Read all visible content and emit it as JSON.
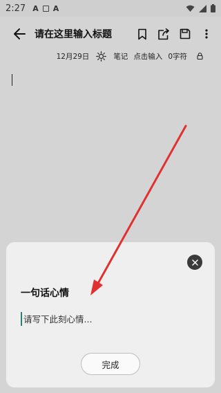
{
  "status_bar": {
    "time": "2:27",
    "left_icons": [
      "a-icon",
      "box-icon",
      "a-icon"
    ],
    "right_icons": [
      "wifi-icon",
      "signal-icon",
      "battery-icon"
    ]
  },
  "app_bar": {
    "title": "请在这里输入标题",
    "actions": [
      "bookmark-icon",
      "share-icon",
      "save-icon",
      "more-icon"
    ]
  },
  "meta": {
    "date": "12月29日",
    "weather_icon": "sun-icon",
    "category": "笔记",
    "input_hint": "点击输入",
    "char_count": "0字符"
  },
  "sheet": {
    "title": "一句话心情",
    "input_placeholder": "请写下此刻心情...",
    "input_value": "",
    "done_label": "完成"
  },
  "colors": {
    "annotation_arrow": "#e03030",
    "cursor": "#2a7d72"
  }
}
